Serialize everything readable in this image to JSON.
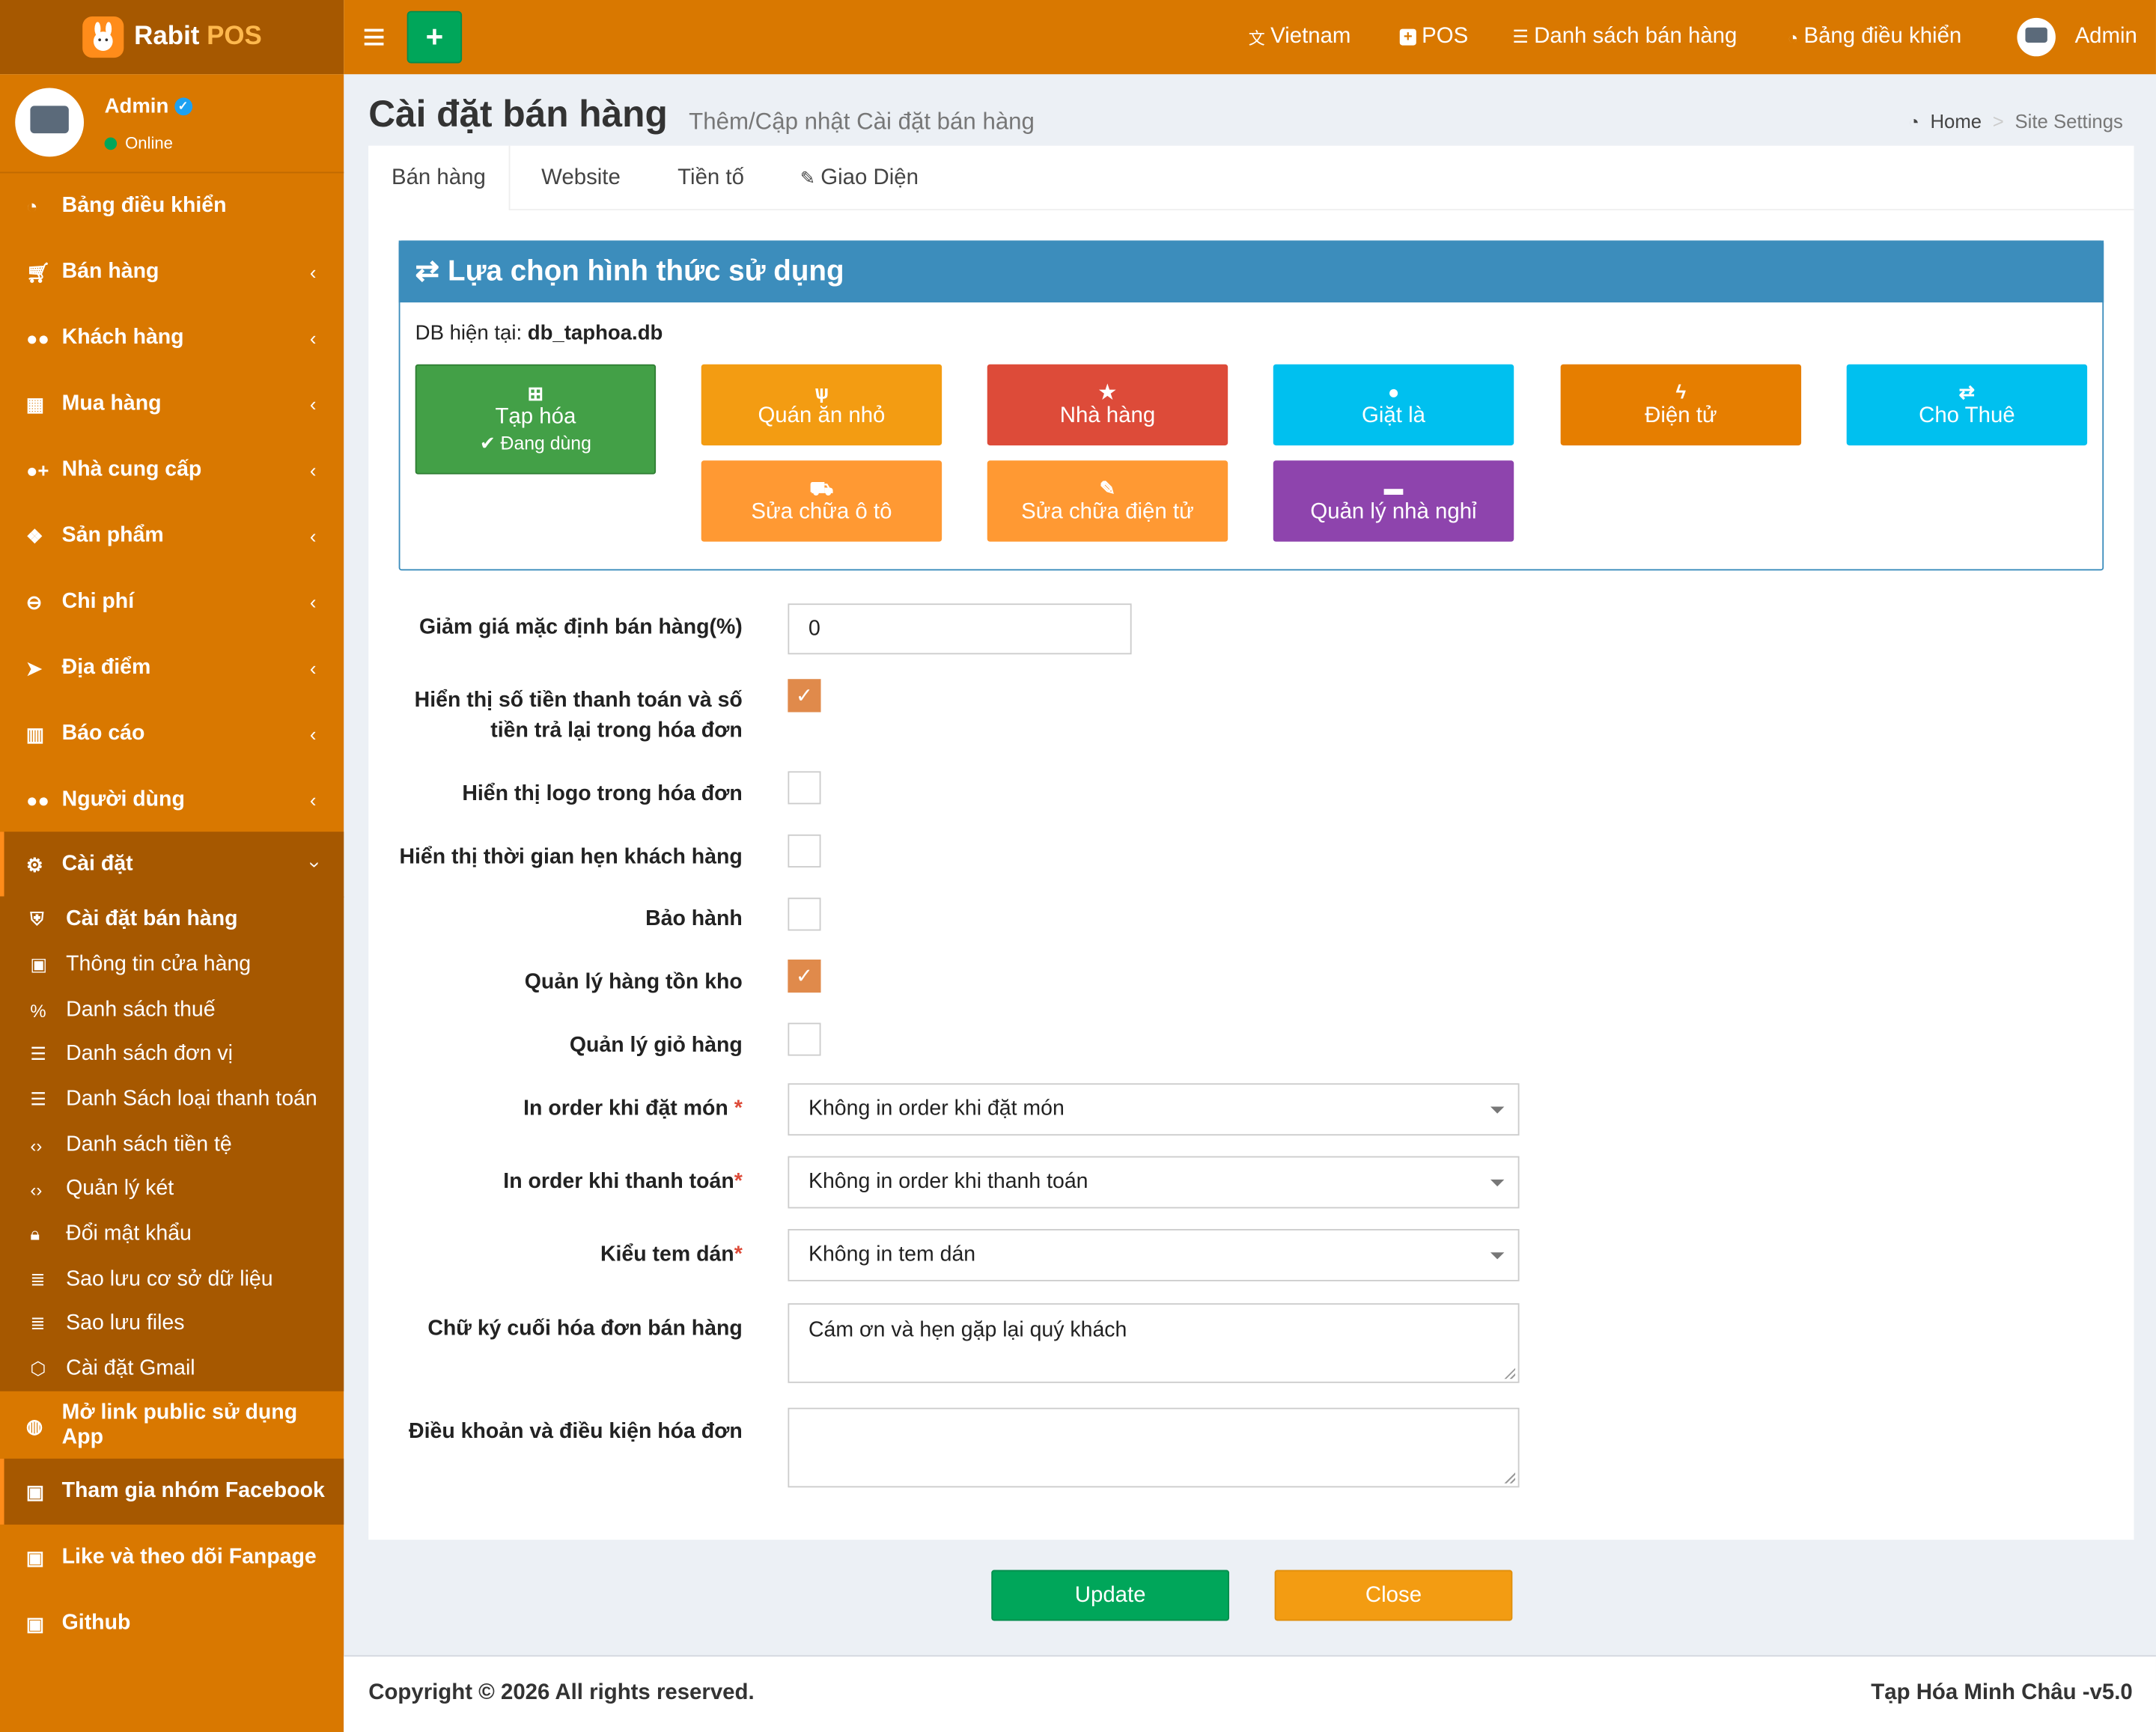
{
  "brand": {
    "name_a": "Rabit",
    "name_b": "POS"
  },
  "topnav": {
    "language": "Vietnam",
    "pos": "POS",
    "sales_list": "Danh sách bán hàng",
    "dashboard": "Bảng điều khiển",
    "user": "Admin"
  },
  "user_panel": {
    "name": "Admin",
    "status": "Online"
  },
  "sidebar": {
    "items": [
      {
        "label": "Bảng điều khiển",
        "icon": "dashboard-icon"
      },
      {
        "label": "Bán hàng",
        "icon": "cart-icon"
      },
      {
        "label": "Khách hàng",
        "icon": "users-icon"
      },
      {
        "label": "Mua hàng",
        "icon": "grid-icon"
      },
      {
        "label": "Nhà cung cấp",
        "icon": "user-plus-icon"
      },
      {
        "label": "Sản phẩm",
        "icon": "cubes-icon"
      },
      {
        "label": "Chi phí",
        "icon": "minus-circle-icon"
      },
      {
        "label": "Địa điểm",
        "icon": "send-icon"
      },
      {
        "label": "Báo cáo",
        "icon": "bar-chart-icon"
      },
      {
        "label": "Người dùng",
        "icon": "users-icon"
      },
      {
        "label": "Cài đặt",
        "icon": "cogs-icon"
      }
    ],
    "submenu": [
      {
        "label": "Cài đặt bán hàng",
        "icon": "shield-icon"
      },
      {
        "label": "Thông tin cửa hàng",
        "icon": "briefcase-icon"
      },
      {
        "label": "Danh sách thuế",
        "icon": "percent-icon"
      },
      {
        "label": "Danh sách đơn vị",
        "icon": "list-icon"
      },
      {
        "label": "Danh Sách loại thanh toán",
        "icon": "list-icon"
      },
      {
        "label": "Danh sách tiền tệ",
        "icon": "code-icon"
      },
      {
        "label": "Quản lý két",
        "icon": "code-icon"
      },
      {
        "label": "Đổi mật khẩu",
        "icon": "lock-icon"
      },
      {
        "label": "Sao lưu cơ sở dữ liệu",
        "icon": "database-icon"
      },
      {
        "label": "Sao lưu files",
        "icon": "database-icon"
      },
      {
        "label": "Cài đặt Gmail",
        "icon": "cube-icon"
      }
    ],
    "extras": [
      {
        "label": "Mở link public sử dụng App",
        "icon": "globe-icon"
      },
      {
        "label": "Tham gia nhóm Facebook",
        "icon": "briefcase-icon"
      },
      {
        "label": "Like và theo dõi Fanpage",
        "icon": "briefcase-icon"
      },
      {
        "label": "Github",
        "icon": "briefcase-icon"
      }
    ]
  },
  "page": {
    "title": "Cài đặt bán hàng",
    "subtitle": "Thêm/Cập nhật Cài đặt bán hàng"
  },
  "breadcrumb": {
    "home": "Home",
    "current": "Site Settings"
  },
  "tabs": [
    "Bán hàng",
    "Website",
    "Tiền tố",
    "Giao Diện"
  ],
  "panel": {
    "title": "Lựa chọn hình thức sử dụng",
    "db_label": "DB hiện tại:",
    "db_name": "db_taphoa.db"
  },
  "business_types": [
    {
      "label": "Tạp hóa",
      "icon": "basket-icon",
      "color": "#43a047",
      "status": "Đang dùng"
    },
    {
      "label": "Quán ăn nhỏ",
      "icon": "cutlery-icon",
      "color": "#f39c12"
    },
    {
      "label": "Nhà hàng",
      "icon": "star-icon",
      "color": "#dd4b39"
    },
    {
      "label": "Giặt là",
      "icon": "drop-icon",
      "color": "#00c0ef"
    },
    {
      "label": "Điện tử",
      "icon": "bolt-icon",
      "color": "#e67e00"
    },
    {
      "label": "Cho Thuê",
      "icon": "exchange-icon",
      "color": "#00c0ef"
    },
    {
      "label": "Sửa chữa ô tô",
      "icon": "car-icon",
      "color": "#ff9933"
    },
    {
      "label": "Sửa chữa điện tử",
      "icon": "wrench-icon",
      "color": "#ff9933"
    },
    {
      "label": "Quản lý nhà nghỉ",
      "icon": "bed-icon",
      "color": "#8e44ad"
    }
  ],
  "form": {
    "discount_label": "Giảm giá mặc định bán hàng(%)",
    "discount_value": "0",
    "show_paid_label_1": "Hiển thị số tiền thanh toán và số",
    "show_paid_label_2": "tiền trả lại trong hóa đơn",
    "show_paid": true,
    "show_logo_label": "Hiển thị logo trong hóa đơn",
    "show_logo": false,
    "show_appt_label": "Hiển thị thời gian hẹn khách hàng",
    "show_appt": false,
    "warranty_label": "Bảo hành",
    "warranty": false,
    "inventory_label": "Quản lý hàng tồn kho",
    "inventory": true,
    "cart_label": "Quản lý giỏ hàng",
    "cart": false,
    "print_order_label": "In order khi đặt món",
    "print_order_value": "Không in order khi đặt món",
    "print_pay_label": "In order khi thanh toán",
    "print_pay_value": "Không in order khi thanh toán",
    "sticker_label": "Kiểu tem dán",
    "sticker_value": "Không in tem dán",
    "signature_label": "Chữ ký cuối hóa đơn bán hàng",
    "signature_value": "Cám ơn và hẹn gặp lại quý khách",
    "terms_label": "Điều khoản và điều kiện hóa đơn",
    "terms_value": ""
  },
  "buttons": {
    "update": "Update",
    "close": "Close"
  },
  "footer": {
    "copyright": "Copyright © 2026 All rights reserved.",
    "version": "Tạp Hóa Minh Châu -v5.0"
  },
  "colors": {
    "sidebar": "#d97800",
    "sidebar_dark": "#a65800",
    "panel": "#3c8dbc",
    "update": "#00a65a",
    "close": "#f39c12",
    "checkbox": "#e08a4b"
  }
}
